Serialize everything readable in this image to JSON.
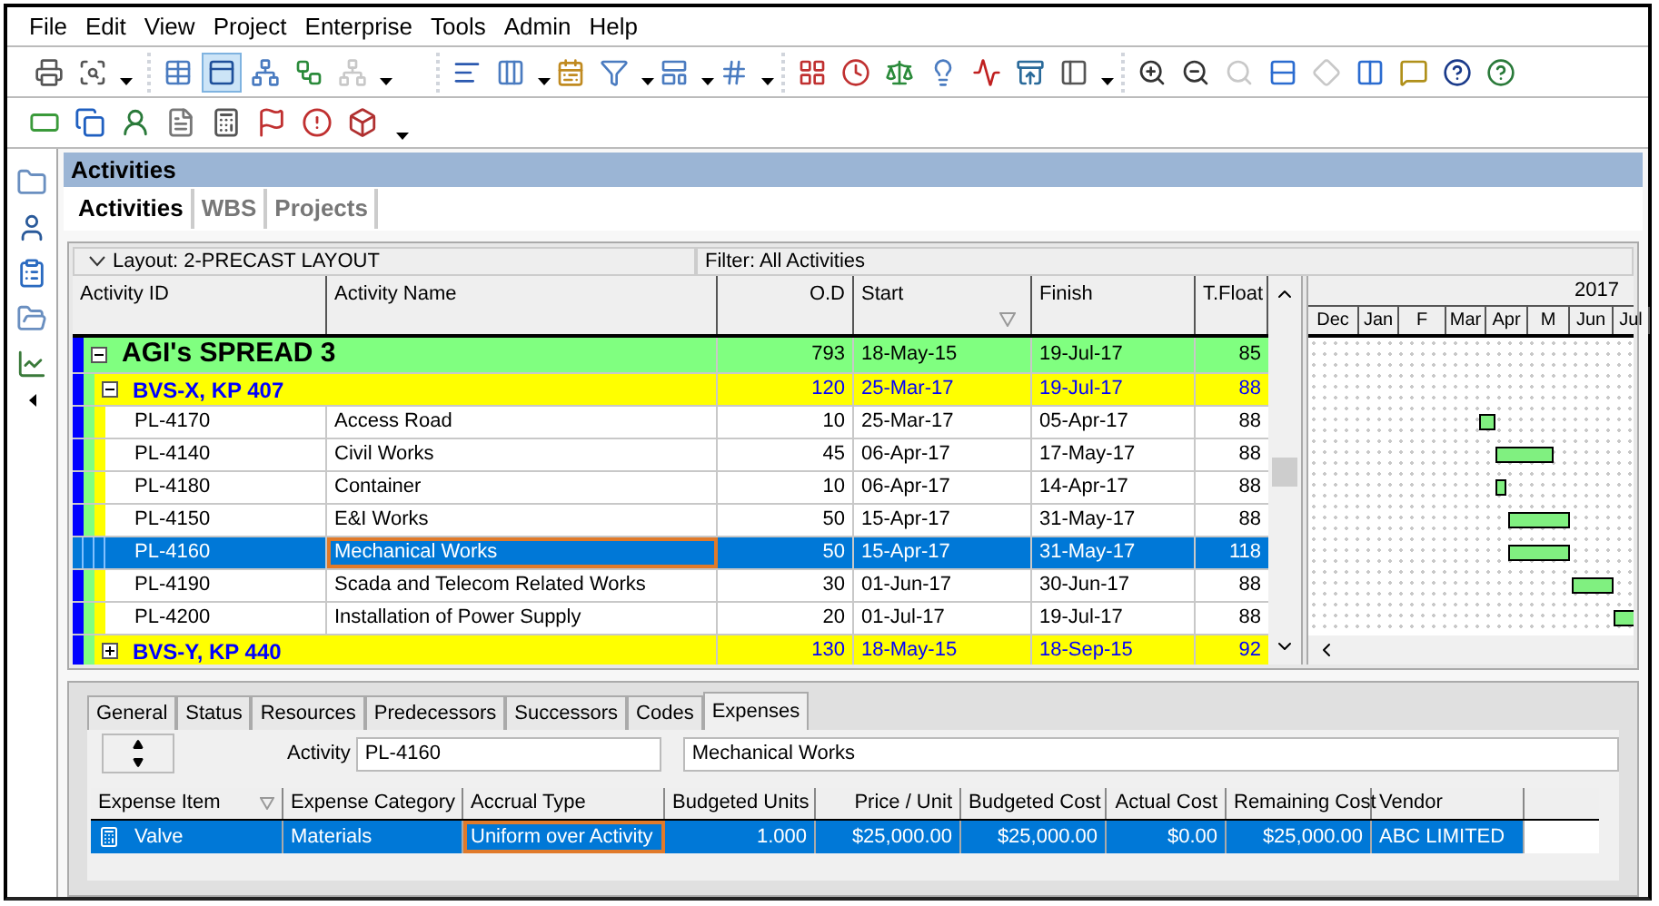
{
  "menu": [
    "File",
    "Edit",
    "View",
    "Project",
    "Enterprise",
    "Tools",
    "Admin",
    "Help"
  ],
  "toolbar": [
    {
      "selected": false,
      "disabled": false
    },
    {
      "selected": false,
      "disabled": false
    },
    {
      "selected": false,
      "disabled": false
    },
    {
      "selected": true,
      "disabled": false
    },
    {
      "selected": false,
      "disabled": false
    },
    {
      "selected": false,
      "disabled": false
    },
    {
      "selected": false,
      "disabled": true
    },
    {
      "selected": false,
      "disabled": false
    },
    {
      "selected": false,
      "disabled": false
    },
    {
      "selected": false,
      "disabled": false
    },
    {
      "selected": false,
      "disabled": false
    },
    {
      "selected": false,
      "disabled": false
    },
    {
      "selected": false,
      "disabled": false
    },
    {
      "selected": false,
      "disabled": false
    },
    {
      "selected": false,
      "disabled": false
    },
    {
      "selected": false,
      "disabled": false
    },
    {
      "selected": false,
      "disabled": false
    },
    {
      "selected": false,
      "disabled": false
    },
    {
      "selected": false,
      "disabled": false
    },
    {
      "selected": false,
      "disabled": false
    },
    {
      "selected": false,
      "disabled": false
    },
    {
      "selected": false,
      "disabled": false
    },
    {
      "selected": false,
      "disabled": true
    },
    {
      "selected": false,
      "disabled": false
    },
    {
      "selected": false,
      "disabled": true
    },
    {
      "selected": false,
      "disabled": false
    },
    {
      "selected": false,
      "disabled": false
    },
    {
      "selected": false,
      "disabled": false
    },
    {
      "selected": false,
      "disabled": false
    }
  ],
  "panel_title": "Activities",
  "tabs": [
    {
      "label": "Activities",
      "selected": true
    },
    {
      "label": "WBS",
      "selected": false
    },
    {
      "label": "Projects",
      "selected": false
    }
  ],
  "layout": "Layout: 2-PRECAST LAYOUT",
  "filter": "Filter: All Activities",
  "columns": [
    "Activity ID",
    "Activity Name",
    "O.D",
    "Start",
    "Finish",
    "T.Float"
  ],
  "rows": [
    {
      "kind": "group",
      "expanded": true,
      "selected": false,
      "name": "AGI's SPREAD 3",
      "od": "793",
      "start": "18-May-15",
      "finish": "19-Jul-17",
      "float": "85"
    },
    {
      "kind": "wbs",
      "expanded": true,
      "selected": false,
      "name": "BVS-X, KP 407",
      "od": "120",
      "start": "25-Mar-17",
      "finish": "19-Jul-17",
      "float": "88"
    },
    {
      "kind": "activity",
      "selected": false,
      "id": "PL-4170",
      "name": "Access Road",
      "od": "10",
      "start": "25-Mar-17",
      "finish": "05-Apr-17",
      "float": "88"
    },
    {
      "kind": "activity",
      "selected": false,
      "id": "PL-4140",
      "name": "Civil Works",
      "od": "45",
      "start": "06-Apr-17",
      "finish": "17-May-17",
      "float": "88"
    },
    {
      "kind": "activity",
      "selected": false,
      "id": "PL-4180",
      "name": "Container",
      "od": "10",
      "start": "06-Apr-17",
      "finish": "14-Apr-17",
      "float": "88"
    },
    {
      "kind": "activity",
      "selected": false,
      "id": "PL-4150",
      "name": "E&I Works",
      "od": "50",
      "start": "15-Apr-17",
      "finish": "31-May-17",
      "float": "88"
    },
    {
      "kind": "activity",
      "selected": true,
      "id": "PL-4160",
      "name": "Mechanical Works",
      "od": "50",
      "start": "15-Apr-17",
      "finish": "31-May-17",
      "float": "118"
    },
    {
      "kind": "activity",
      "selected": false,
      "id": "PL-4190",
      "name": "Scada and Telecom Related Works",
      "od": "30",
      "start": "01-Jun-17",
      "finish": "30-Jun-17",
      "float": "88"
    },
    {
      "kind": "activity",
      "selected": false,
      "id": "PL-4200",
      "name": "Installation of Power Supply",
      "od": "20",
      "start": "01-Jul-17",
      "finish": "19-Jul-17",
      "float": "88"
    },
    {
      "kind": "wbs",
      "expanded": false,
      "selected": false,
      "name": "BVS-Y, KP 440",
      "od": "130",
      "start": "18-May-15",
      "finish": "18-Sep-15",
      "float": "92"
    }
  ],
  "gantt": {
    "year": "2017",
    "months": [
      "Dec",
      "Jan",
      "F",
      "Mar",
      "Apr",
      "M",
      "Jun",
      "Jul"
    ]
  },
  "detail_tabs": [
    {
      "label": "General",
      "selected": false
    },
    {
      "label": "Status",
      "selected": false
    },
    {
      "label": "Resources",
      "selected": false
    },
    {
      "label": "Predecessors",
      "selected": false
    },
    {
      "label": "Successors",
      "selected": false
    },
    {
      "label": "Codes",
      "selected": false
    },
    {
      "label": "Expenses",
      "selected": true
    }
  ],
  "activity_label": "Activity",
  "activity_id": "PL-4160",
  "activity_name": "Mechanical Works",
  "expense_columns": [
    "Expense Item",
    "Expense Category",
    "Accrual Type",
    "Budgeted Units",
    "Price / Unit",
    "Budgeted Cost",
    "Actual Cost",
    "Remaining Cost",
    "Vendor"
  ],
  "expenses": [
    {
      "selected": true,
      "item": "Valve",
      "category": "Materials",
      "accrual": "Uniform over Activity",
      "units": "1.000",
      "price": "$25,000.00",
      "budgeted": "$25,000.00",
      "actual": "$0.00",
      "remaining": "$25,000.00",
      "vendor": "ABC LIMITED"
    }
  ]
}
